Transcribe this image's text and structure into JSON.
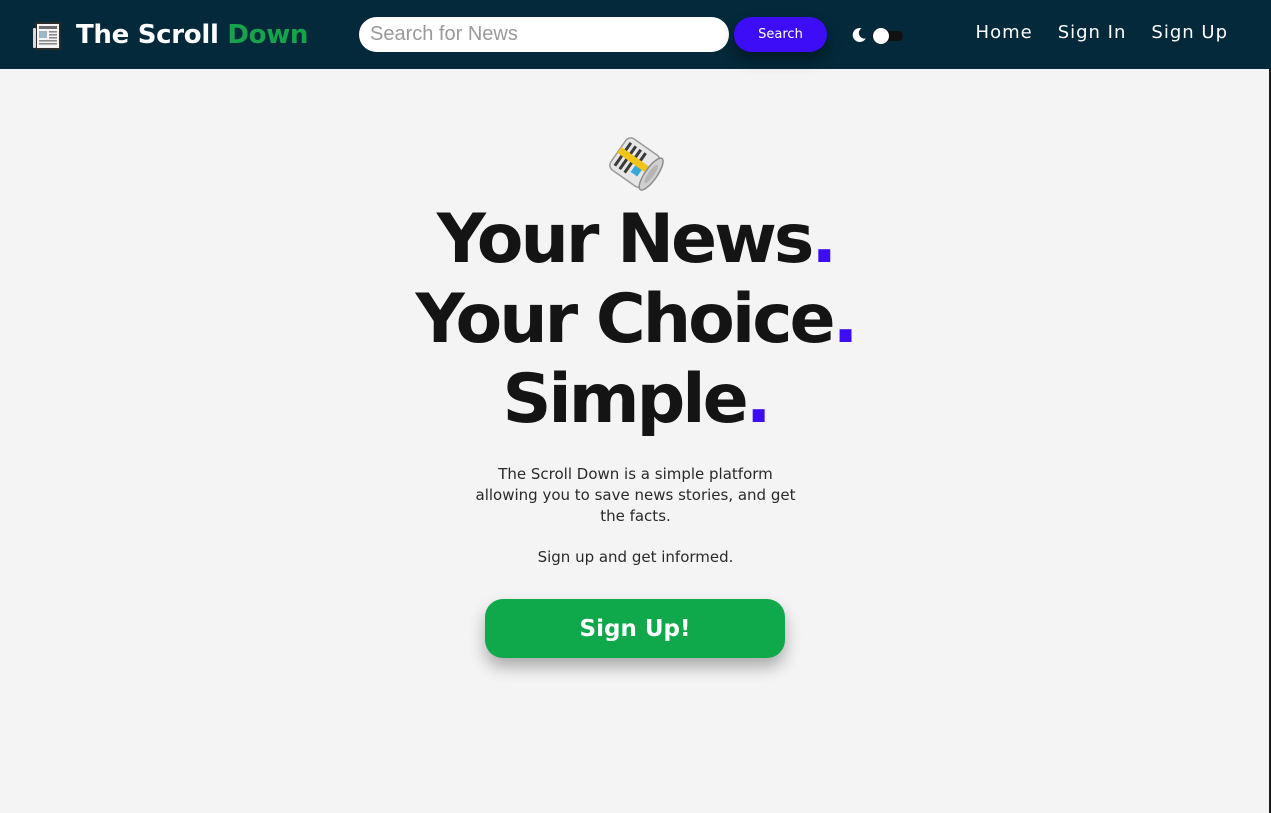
{
  "navbar": {
    "brand": {
      "title_main": "The Scroll",
      "title_accent": "Down",
      "icon": "newspaper-icon"
    },
    "search": {
      "placeholder": "Search for News",
      "value": "",
      "button_label": "Search"
    },
    "theme_toggle": {
      "icon": "moon-icon",
      "state": "off"
    },
    "links": [
      {
        "label": "Home"
      },
      {
        "label": "Sign In"
      },
      {
        "label": "Sign Up"
      }
    ]
  },
  "hero": {
    "icon": "rolled-newspaper-icon",
    "headline": [
      {
        "text": "Your News",
        "dot": "."
      },
      {
        "text": "Your Choice",
        "dot": "."
      },
      {
        "text": "Simple",
        "dot": "."
      }
    ],
    "description": "The Scroll Down is a simple platform allowing you to save news stories, and get the facts.",
    "cta_text": "Sign up and get informed.",
    "button_label": "Sign Up!"
  },
  "colors": {
    "navbar_bg": "#04293a",
    "accent_green": "#16a34a",
    "accent_purple": "#3d0df7",
    "button_green": "#0fa84b",
    "page_bg": "#f4f4f4"
  }
}
